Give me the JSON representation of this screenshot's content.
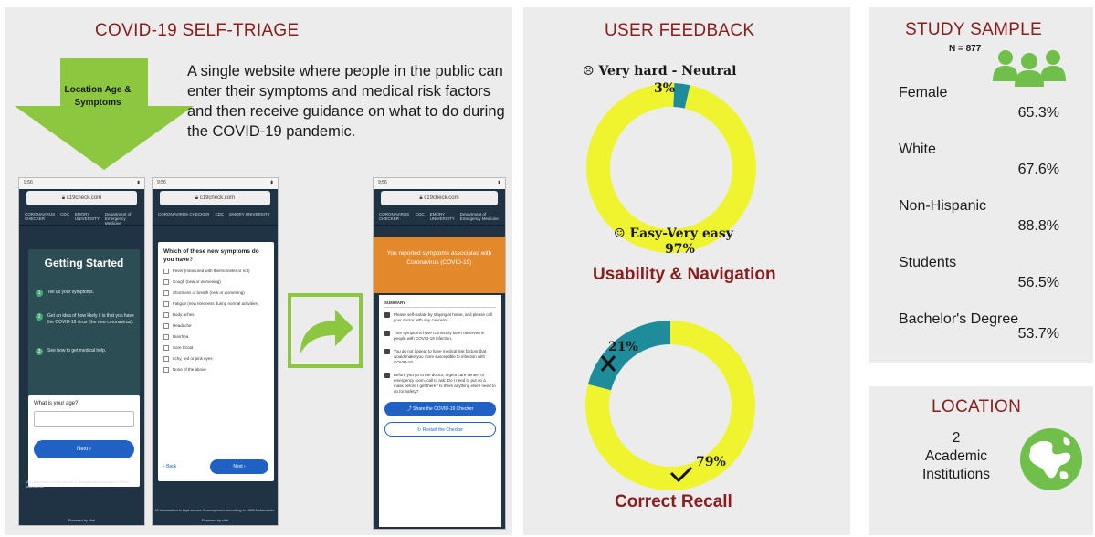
{
  "triage": {
    "title": "COVID-19 SELF-TRIAGE",
    "arrow_label": "Location Age & Symptoms",
    "description": "A single website where people in the public can enter their symptoms and medical risk factors and then receive guidance on what to do during the COVID-19 pandemic.",
    "phone1": {
      "status_time": "9:56",
      "url": "c19check.com",
      "nav": [
        "CORONAVIRUS CHECKER",
        "CDC",
        "EMORY UNIVERSITY",
        "Department of Emergency Medicine"
      ],
      "heading": "Getting Started",
      "steps": [
        "Tell us your symptoms.",
        "Get an idea of how likely it is that you have the COVID-19 virus (the new coronavirus).",
        "See how to get medical help."
      ],
      "age_label": "What is your age?",
      "next_label": "Next",
      "info": "All information is kept secure & anonymous according to HIPAA standards.",
      "powered": "Powered by vital"
    },
    "phone2": {
      "status_time": "9:56",
      "url": "c19check.com",
      "question": "Which of these new symptoms do you have?",
      "options": [
        "Fever (measured with thermometer or not)",
        "Cough (new or worsening)",
        "Shortness of breath (new or worsening)",
        "Fatigue (new tiredness during normal activities)",
        "Body aches",
        "Headache",
        "Diarrhea",
        "Sore throat",
        "Itchy, red or pink eyes",
        "None of the above"
      ],
      "back_label": "Back",
      "next_label": "Next",
      "info": "All information is kept secure & anonymous according to HIPAA standards.",
      "powered": "Powered by vital"
    },
    "phone3": {
      "status_time": "9:56",
      "url": "c19check.com",
      "banner": "You reported symptoms associated with Coronavirus (COVID-19)",
      "summary_label": "SUMMARY",
      "items": [
        "Please self-isolate by staying at home, and please call your doctor with any concerns.",
        "Your symptoms have commonly been observed in people with COVID-19 infection.",
        "You do not appear to have medical risk factors that would make you more susceptible to infection with COVID-19.",
        "Before you go to the doctor, urgent care center, or emergency room, call to ask: Do I need to put on a mask before I get there? Is there anything else I need to do for safety?"
      ],
      "share_label": "Share the COVID-19 Checker",
      "restart_label": "Restart the Checker"
    }
  },
  "feedback": {
    "title": "USER FEEDBACK"
  },
  "chart_data": [
    {
      "type": "pie",
      "title": "Usability & Navigation",
      "donut": true,
      "slices": [
        {
          "label": "Very hard - Neutral",
          "value": 3,
          "value_label": "3%",
          "color": "#1e8c9a"
        },
        {
          "label": "Easy-Very easy",
          "value": 97,
          "value_label": "97%",
          "color": "#eef52e"
        }
      ]
    },
    {
      "type": "pie",
      "title": "Correct Recall",
      "donut": true,
      "slices": [
        {
          "label": "Incorrect",
          "value": 21,
          "value_label": "21%",
          "color": "#1e8c9a"
        },
        {
          "label": "Correct",
          "value": 79,
          "value_label": "79%",
          "color": "#eef52e"
        }
      ]
    }
  ],
  "sample": {
    "title": "STUDY SAMPLE",
    "n_label": "N = 877",
    "icon": "people-icon",
    "rows": [
      {
        "label": "Female",
        "value": "65.3%"
      },
      {
        "label": "White",
        "value": "67.6%"
      },
      {
        "label": "Non-Hispanic",
        "value": "88.8%"
      },
      {
        "label": "Students",
        "value": "56.5%"
      },
      {
        "label": "Bachelor's Degree",
        "value": "53.7%"
      }
    ]
  },
  "location": {
    "title": "LOCATION",
    "count": "2",
    "line1": "Academic",
    "line2": "Institutions",
    "icon": "globe-icon"
  },
  "colors": {
    "title_red": "#8b1c1c",
    "arrow_green": "#8dc63f",
    "icon_green": "#6fbf4a",
    "donut_yellow": "#eef52e",
    "donut_teal": "#1e8c9a"
  }
}
